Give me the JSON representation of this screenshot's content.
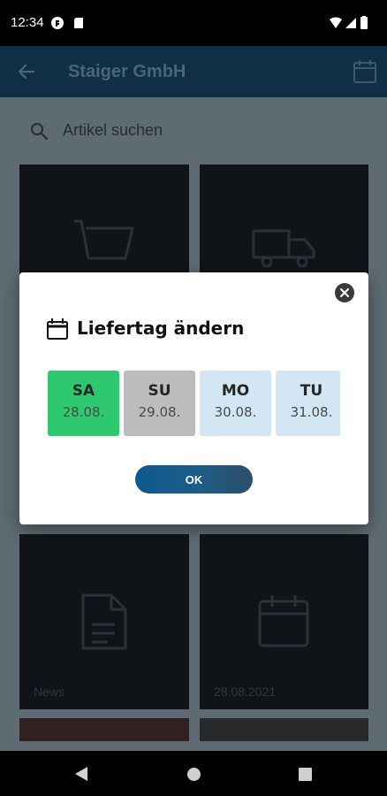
{
  "status_bar": {
    "time": "12:34"
  },
  "app_bar": {
    "title": "Staiger GmbH",
    "back_icon": "arrow-left-icon",
    "calendar_icon": "calendar-icon"
  },
  "search": {
    "placeholder": "Artikel suchen",
    "icon": "search-icon"
  },
  "tiles": {
    "cart_icon": "shopping-cart-icon",
    "truck_icon": "delivery-truck-icon",
    "news_icon": "document-icon",
    "news_caption": "News",
    "delivery_icon": "calendar-icon",
    "delivery_caption": "28.08.2021"
  },
  "dialog": {
    "title": "Liefertag ändern",
    "close_icon": "close-icon",
    "days": [
      {
        "name": "SA",
        "date": "28.08.",
        "state": "selected",
        "color": "#2ec96f"
      },
      {
        "name": "SU",
        "date": "29.08.",
        "state": "unavailable",
        "color": "#bdbdbd"
      },
      {
        "name": "MO",
        "date": "30.08.",
        "state": "available",
        "color": "#d2e6f4"
      },
      {
        "name": "TU",
        "date": "31.08.",
        "state": "available",
        "color": "#d2e6f4"
      }
    ],
    "ok_label": "OK"
  },
  "colors": {
    "app_bar": "#0f2f45",
    "overlay_background": "#5e6b72",
    "tile": "#101318",
    "ok_button": "#0e5a8f"
  }
}
